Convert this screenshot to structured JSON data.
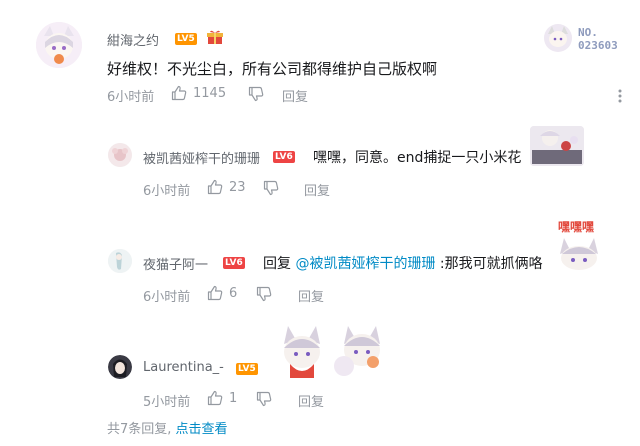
{
  "main_comment": {
    "username": "紺海之约",
    "level": "LV5",
    "content": "好维权！不光尘白，所有公司都得维护自己版权啊",
    "time": "6小时前",
    "likes": "1145",
    "reply_label": "回复",
    "badge_text": "NO.",
    "badge_number": "023603"
  },
  "replies": [
    {
      "username": "被凯茜娅榨干的珊珊",
      "level": "LV6",
      "content": "嘿嘿，同意。end捕捉一只小米花",
      "time": "6小时前",
      "likes": "23",
      "reply_label": "回复"
    },
    {
      "username": "夜猫子阿一",
      "level": "LV6",
      "prefix": "回复",
      "mention": "@被凯茜娅榨干的珊珊",
      "content": " :那我可就抓俩咯",
      "time": "6小时前",
      "likes": "6",
      "reply_label": "回复",
      "sticker_text": "嘿嘿嘿"
    },
    {
      "username": "Laurentina_-",
      "level": "LV5",
      "time": "5小时前",
      "likes": "1",
      "reply_label": "回复"
    }
  ],
  "footer": {
    "count_text": "共7条回复,",
    "view_link": "点击查看"
  },
  "colors": {
    "accent_link": "#008ac5",
    "meta_gray": "#9499a0",
    "lv5": "#ff9500",
    "lv6": "#ee4444"
  },
  "icons": [
    "like-icon",
    "dislike-icon",
    "more-icon",
    "gift-icon"
  ]
}
